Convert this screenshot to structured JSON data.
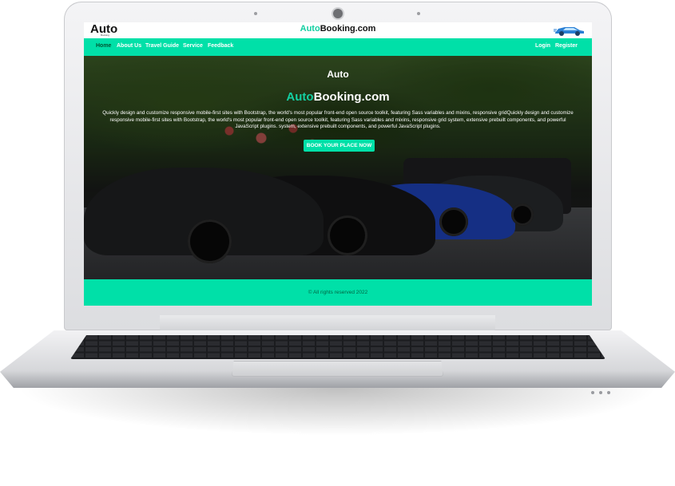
{
  "site": {
    "logo_text": "Auto",
    "logo_subtext": "Booking",
    "title_prefix": "Auto",
    "title_suffix": "Booking.com"
  },
  "nav": {
    "left": [
      "Home",
      "About Us",
      "Travel Guide",
      "Service",
      "Feedback"
    ],
    "right": [
      "Login",
      "Register"
    ]
  },
  "hero": {
    "logo_text": "Auto",
    "title_prefix": "Auto",
    "title_suffix": "Booking.com",
    "description": "Quickly design and customize responsive mobile-first sites with Bootstrap, the world's most popular front-end open source toolkit, featuring Sass variables and mixins, responsive gridQuickly design and customize responsive mobile-first sites with Bootstrap, the world's most popular front-end open source toolkit, featuring Sass variables and mixins, responsive grid system, extensive prebuilt components, and powerful JavaScript plugins. system, extensive prebuilt components, and powerful JavaScript plugins.",
    "button_label": "BOOK YOUR PLACE NOW"
  },
  "footer": {
    "copyright": "© All rights reserved 2022"
  },
  "colors": {
    "accent": "#00e0a8",
    "accent_text": "#14cfa2"
  },
  "icons": [
    "car-icon",
    "camera-icon"
  ]
}
